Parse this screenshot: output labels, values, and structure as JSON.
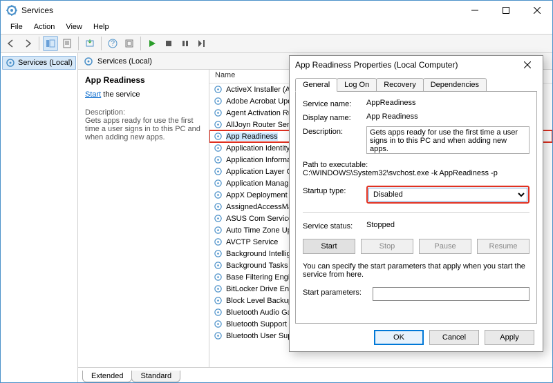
{
  "window": {
    "title": "Services",
    "menu": [
      "File",
      "Action",
      "View",
      "Help"
    ]
  },
  "tree": {
    "root": "Services (Local)"
  },
  "header": {
    "title": "Services (Local)"
  },
  "details": {
    "title": "App Readiness",
    "start_link": "Start",
    "start_suffix": " the service",
    "desc_label": "Description:",
    "desc_text": "Gets apps ready for use the first time a user signs in to this PC and when adding new apps."
  },
  "list": {
    "name_col": "Name",
    "items": [
      "ActiveX Installer (Ax",
      "Adobe Acrobat Upd",
      "Agent Activation Ru",
      "AllJoyn Router Servi",
      "App Readiness",
      "Application Identity",
      "Application Informa",
      "Application Layer G",
      "Application Manage",
      "AppX Deployment S",
      "AssignedAccessMan",
      "ASUS Com Service",
      "Auto Time Zone Up",
      "AVCTP Service",
      "Background Intellig",
      "Background Tasks In",
      "Base Filtering Engin",
      "BitLocker Drive Encr",
      "Block Level Backup",
      "Bluetooth Audio Ga",
      "Bluetooth Support S",
      "Bluetooth User Supp"
    ],
    "highlight_index": 4
  },
  "bottom_tabs": {
    "extended": "Extended",
    "standard": "Standard"
  },
  "dialog": {
    "title": "App Readiness Properties (Local Computer)",
    "tabs": [
      "General",
      "Log On",
      "Recovery",
      "Dependencies"
    ],
    "active_tab": 0,
    "service_name_label": "Service name:",
    "service_name": "AppReadiness",
    "display_name_label": "Display name:",
    "display_name": "App Readiness",
    "description_label": "Description:",
    "description": "Gets apps ready for use the first time a user signs in to this PC and when adding new apps.",
    "path_label": "Path to executable:",
    "path_value": "C:\\WINDOWS\\System32\\svchost.exe -k AppReadiness -p",
    "startup_label": "Startup type:",
    "startup_value": "Disabled",
    "status_label": "Service status:",
    "status_value": "Stopped",
    "btn_start": "Start",
    "btn_stop": "Stop",
    "btn_pause": "Pause",
    "btn_resume": "Resume",
    "note": "You can specify the start parameters that apply when you start the service from here.",
    "params_label": "Start parameters:",
    "params_value": "",
    "ok": "OK",
    "cancel": "Cancel",
    "apply": "Apply"
  }
}
